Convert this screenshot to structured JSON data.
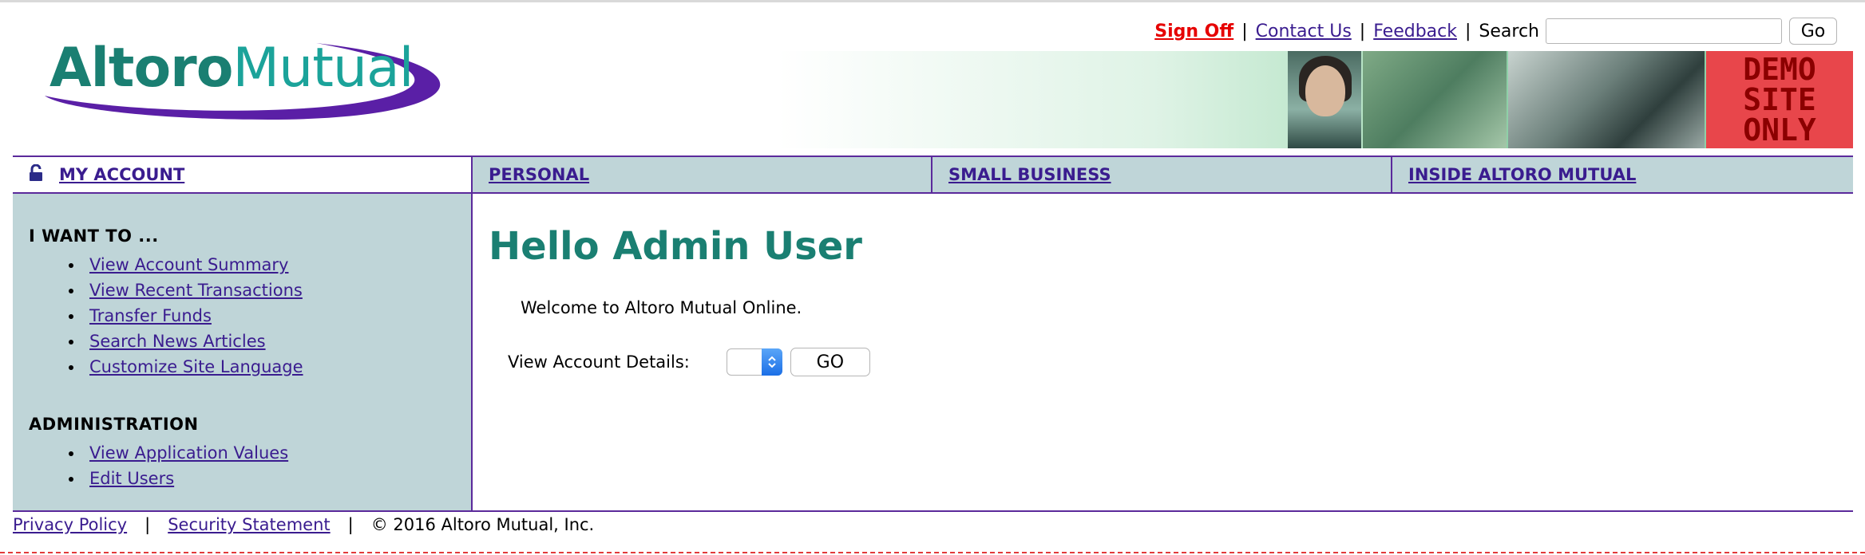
{
  "header": {
    "logo": {
      "part1": "Altoro",
      "part2": "Mutual"
    },
    "top_links": {
      "sign_off": "Sign Off",
      "separator": "|",
      "contact_us": "Contact Us",
      "feedback": "Feedback",
      "search_label": "Search",
      "search_value": "",
      "go": "Go"
    },
    "banner": {
      "demo_lines": [
        "DEMO",
        "SITE",
        "ONLY"
      ]
    }
  },
  "nav": {
    "tabs": [
      {
        "label": "MY ACCOUNT",
        "icon": "lock-icon"
      },
      {
        "label": "PERSONAL"
      },
      {
        "label": "SMALL BUSINESS"
      },
      {
        "label": "INSIDE ALTORO MUTUAL"
      }
    ]
  },
  "sidebar": {
    "sections": [
      {
        "title": "I WANT TO ...",
        "items": [
          "View Account Summary",
          "View Recent Transactions",
          "Transfer Funds",
          "Search News Articles",
          "Customize Site Language"
        ]
      },
      {
        "title": "ADMINISTRATION",
        "items": [
          "View Application Values",
          "Edit Users"
        ]
      }
    ]
  },
  "main": {
    "greeting": "Hello Admin User",
    "welcome": "Welcome to Altoro Mutual Online.",
    "details_label": "View Account Details:",
    "details_selected": "",
    "go": "GO"
  },
  "footer": {
    "privacy": "Privacy Policy",
    "security": "Security Statement",
    "separator": "|",
    "copyright": "© 2016 Altoro Mutual, Inc."
  },
  "colors": {
    "brand_teal": "#1a7f72",
    "nav_purple": "#5b2a9b",
    "panel_bg": "#bfd5d8",
    "link": "#3a1c8f",
    "sign_off_red": "#e60000"
  }
}
